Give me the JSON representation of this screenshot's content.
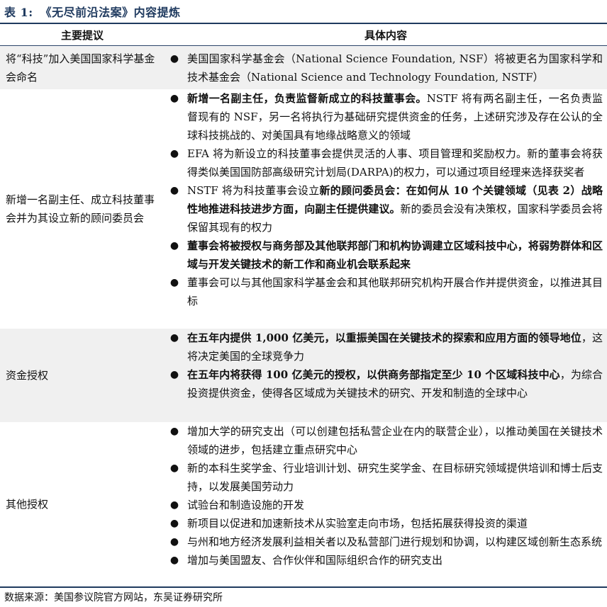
{
  "caption": {
    "number": "表 1:",
    "title": "《无尽前沿法案》内容提炼"
  },
  "header": {
    "col1": "主要提议",
    "col2": "具体内容"
  },
  "rows": [
    {
      "label": "将“科技”加入美国国家科学基金会命名",
      "bullets": [
        {
          "parts": [
            {
              "t": "美国国家科学基金会（National Science Foundation, NSF）将被更名为国家科学和技术基金会（National Science and Technology Foundation, NSTF）",
              "b": false
            }
          ]
        }
      ]
    },
    {
      "label": "新增一名副主任、成立科技董事会并为其设立新的顾问委员会",
      "bullets": [
        {
          "parts": [
            {
              "t": "新增一名副主任，负责监督新成立的科技董事会。",
              "b": true
            },
            {
              "t": "NSTF 将有两名副主任，一名负责监督现有的 NSF，另一名将执行为基础研究提供资金的任务，上述研究涉及存在公认的全球科技挑战的、对美国具有地缘战略意义的领域",
              "b": false
            }
          ]
        },
        {
          "parts": [
            {
              "t": "EFA 将为新设立的科技董事会提供灵活的人事、项目管理和奖励权力。新的董事会将获得类似美国国防部高级研究计划局(DARPA)的权力，可以通过项目经理来选择获奖者",
              "b": false
            }
          ]
        },
        {
          "parts": [
            {
              "t": "NSTF 将为科技董事会设立",
              "b": false
            },
            {
              "t": "新的顾问委员会：在如何从 10 个关键领域（见表 2）战略性地推进科技进步方面，向副主任提供建议。",
              "b": true
            },
            {
              "t": "新的委员会没有决策权，国家科学委员会将保留其现有的权力",
              "b": false
            }
          ]
        },
        {
          "parts": [
            {
              "t": "董事会将被授权与商务部及其他联邦部门和机构协调建立区域科技中心，将弱势群体和区域与开发关键技术的新工作和商业机会联系起来",
              "b": true
            }
          ]
        },
        {
          "parts": [
            {
              "t": "董事会可以与其他国家科学基金会和其他联邦研究机构开展合作并提供资金，以推进其目标",
              "b": false
            }
          ]
        }
      ]
    },
    {
      "label": "资金授权",
      "bullets": [
        {
          "parts": [
            {
              "t": "在五年内提供 1,000 亿美元，以重振美国在关键技术的探索和应用方面的领导地位",
              "b": true
            },
            {
              "t": "，这将决定美国的全球竞争力",
              "b": false
            }
          ]
        },
        {
          "parts": [
            {
              "t": "在五年内将获得 100 亿美元的授权，以供商务部指定至少 10 个区域科技中心",
              "b": true
            },
            {
              "t": "，为综合投资提供资金，使得各区域成为关键技术的研究、开发和制造的全球中心",
              "b": false
            }
          ]
        }
      ]
    },
    {
      "label": "其他授权",
      "bullets": [
        {
          "parts": [
            {
              "t": "增加大学的研究支出（可以创建包括私营企业在内的联营企业），以推动美国在关键技术领域的进步，包括建立重点研究中心",
              "b": false
            }
          ]
        },
        {
          "parts": [
            {
              "t": "新的本科生奖学金、行业培训计划、研究生奖学金、在目标研究领域提供培训和博士后支持，以发展美国劳动力",
              "b": false
            }
          ]
        },
        {
          "parts": [
            {
              "t": "试验台和制造设施的开发",
              "b": false
            }
          ]
        },
        {
          "parts": [
            {
              "t": "新项目以促进和加速新技术从实验室走向市场，包括拓展获得投资的渠道",
              "b": false
            }
          ]
        },
        {
          "parts": [
            {
              "t": "与州和地方经济发展利益相关者以及私营部门进行规划和协调，以构建区域创新生态系统",
              "b": false
            }
          ]
        },
        {
          "parts": [
            {
              "t": "增加与美国盟友、合作伙伴和国际组织合作的研究支出",
              "b": false
            }
          ]
        }
      ]
    }
  ],
  "source": "数据来源：美国参议院官方网站，东吴证券研究所"
}
